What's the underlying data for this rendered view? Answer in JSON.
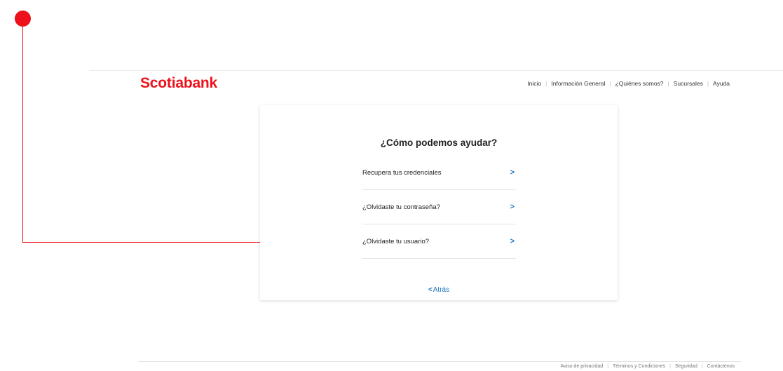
{
  "header": {
    "logo": "Scotiabank",
    "nav": [
      "Inicio",
      "Información General",
      "¿Quiénes somos?",
      "Sucursales",
      "Ayuda"
    ]
  },
  "card": {
    "title": "¿Cómo podemos ayudar?",
    "options": [
      {
        "label": "Recupera tus credenciales",
        "icon": "chevron-right-icon"
      },
      {
        "label": "¿Olvidaste tu contraseña?",
        "icon": "chevron-right-icon"
      },
      {
        "label": "¿Olvidaste tu usuario?",
        "icon": "chevron-right-icon"
      }
    ],
    "back_label": "Atrás"
  },
  "footer": {
    "links": [
      "Aviso de privacidad",
      "Términos y Condiciones",
      "Seguridad",
      "Contáctenos"
    ]
  },
  "colors": {
    "brand_red": "#ec111a",
    "link_blue": "#1e73be"
  }
}
